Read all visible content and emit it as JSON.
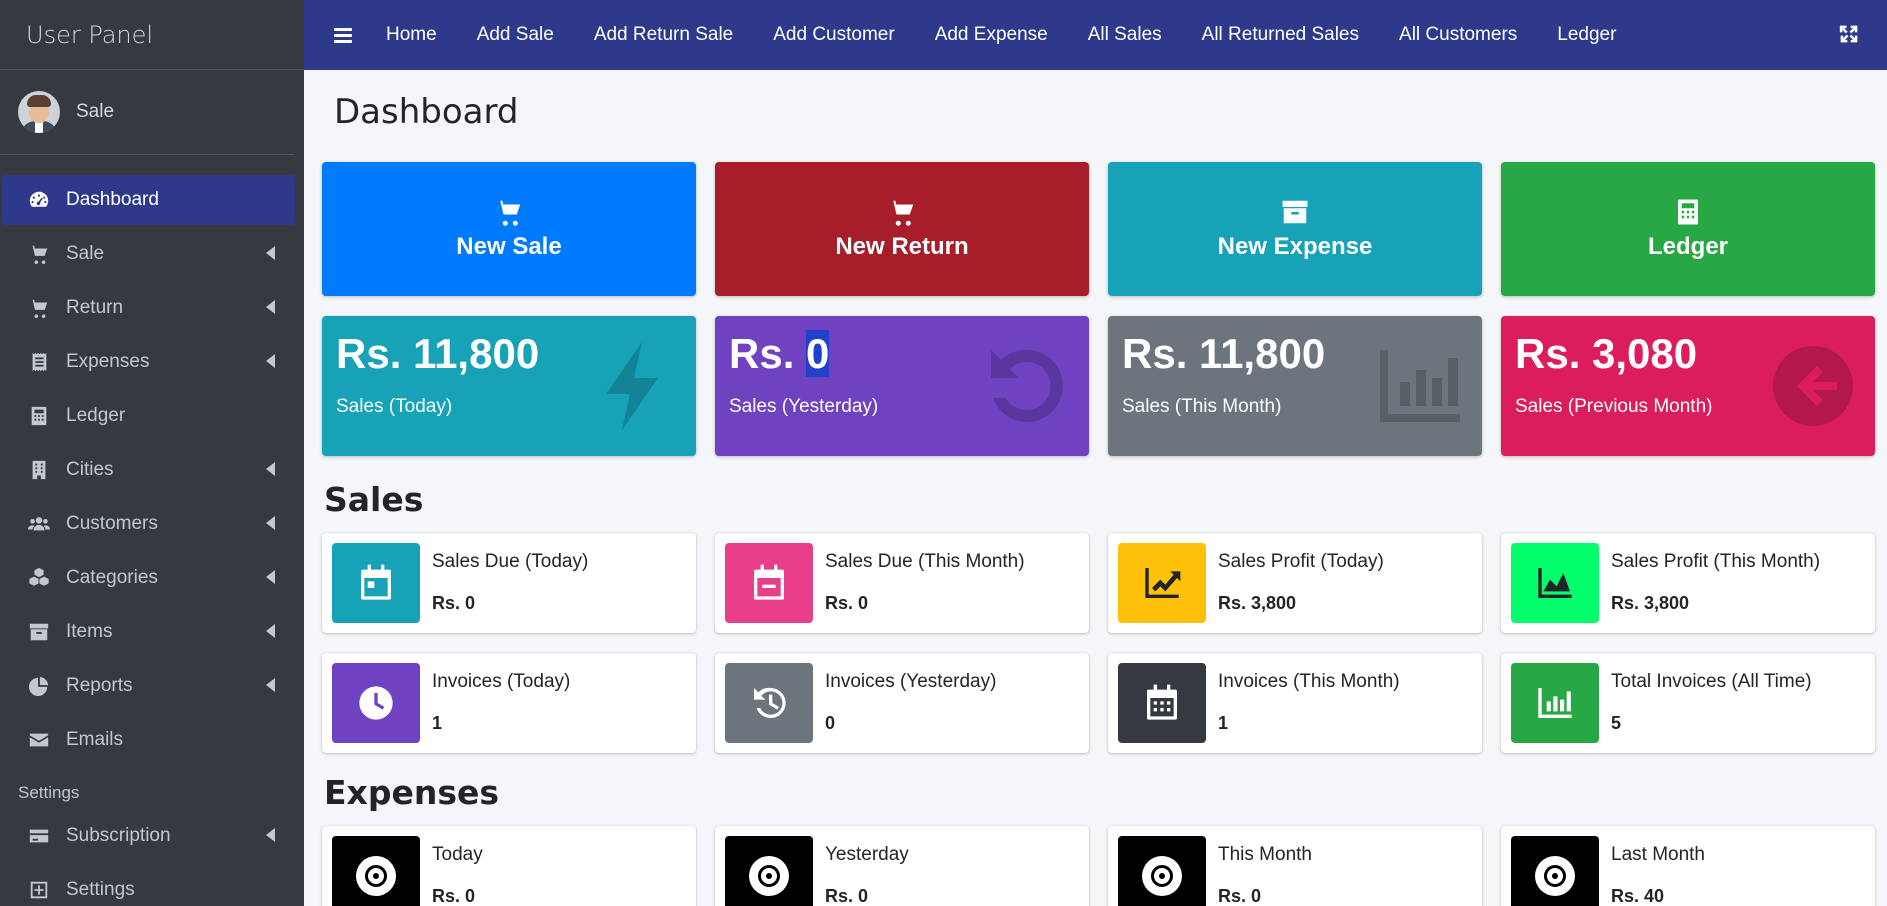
{
  "sidebar": {
    "brand": "User Panel",
    "user_name": "Sale",
    "items": [
      {
        "label": "Dashboard",
        "icon": "dashboard-gauge-icon"
      },
      {
        "label": "Sale",
        "icon": "cart-plus-icon"
      },
      {
        "label": "Return",
        "icon": "cart-return-icon"
      },
      {
        "label": "Expenses",
        "icon": "receipt-icon"
      },
      {
        "label": "Ledger",
        "icon": "calculator-icon"
      },
      {
        "label": "Cities",
        "icon": "building-icon"
      },
      {
        "label": "Customers",
        "icon": "users-icon"
      },
      {
        "label": "Categories",
        "icon": "cubes-icon"
      },
      {
        "label": "Items",
        "icon": "archive-icon"
      },
      {
        "label": "Reports",
        "icon": "pie-chart-icon"
      },
      {
        "label": "Emails",
        "icon": "envelope-icon"
      }
    ],
    "settings_header": "Settings",
    "settings_items": [
      {
        "label": "Subscription",
        "icon": "credit-card-icon"
      },
      {
        "label": "Settings",
        "icon": "plus-square-icon"
      }
    ]
  },
  "topbar": {
    "links": [
      "Home",
      "Add Sale",
      "Add Return Sale",
      "Add Customer",
      "Add Expense",
      "All Sales",
      "All Returned Sales",
      "All Customers",
      "Ledger"
    ]
  },
  "main": {
    "title": "Dashboard",
    "actions": [
      {
        "label": "New Sale",
        "color": "#007bff",
        "icon": "cart-plus-icon"
      },
      {
        "label": "New Return",
        "color": "#a71d2a",
        "icon": "cart-return-icon"
      },
      {
        "label": "New Expense",
        "color": "#17a2b8",
        "icon": "archive-icon"
      },
      {
        "label": "Ledger",
        "color": "#28a745",
        "icon": "calculator-icon"
      }
    ],
    "stats": [
      {
        "prefix": "Rs. ",
        "value": "11,800",
        "caption": "Sales (Today)",
        "color": "#17a2b8",
        "icon": "bolt-icon"
      },
      {
        "prefix": "Rs. ",
        "value": "0",
        "caption": "Sales (Yesterday)",
        "color": "#6f42c1",
        "icon": "undo-icon"
      },
      {
        "prefix": "Rs. ",
        "value": "11,800",
        "caption": "Sales (This Month)",
        "color": "#6c757d",
        "icon": "bar-chart-icon"
      },
      {
        "prefix": "Rs. ",
        "value": "3,080",
        "caption": "Sales (Previous Month)",
        "color": "#dc1d5c",
        "icon": "arrow-circle-left-icon"
      }
    ],
    "sales_title": "Sales",
    "sales_row1": [
      {
        "label": "Sales Due (Today)",
        "value": "Rs. 0",
        "color": "#17a2b8",
        "icon": "calendar-icon"
      },
      {
        "label": "Sales Due (This Month)",
        "value": "Rs. 0",
        "color": "#e83e8c",
        "icon": "calendar-minus-icon"
      },
      {
        "label": "Sales Profit (Today)",
        "value": "Rs. 3,800",
        "color": "#ffc107",
        "icon": "line-chart-icon"
      },
      {
        "label": "Sales Profit (This Month)",
        "value": "Rs. 3,800",
        "color": "#00ff6a",
        "icon": "area-chart-icon"
      }
    ],
    "sales_row2": [
      {
        "label": "Invoices (Today)",
        "value": "1",
        "color": "#6f42c1",
        "icon": "clock-icon"
      },
      {
        "label": "Invoices (Yesterday)",
        "value": "0",
        "color": "#6c757d",
        "icon": "history-icon"
      },
      {
        "label": "Invoices (This Month)",
        "value": "1",
        "color": "#343a40",
        "icon": "calendar-grid-icon"
      },
      {
        "label": "Total Invoices (All Time)",
        "value": "5",
        "color": "#28a745",
        "icon": "bar-chart-icon"
      }
    ],
    "expenses_title": "Expenses",
    "expenses_row": [
      {
        "label": "Today",
        "value": "Rs. 0",
        "color": "#000000",
        "icon": "dot-circle-icon"
      },
      {
        "label": "Yesterday",
        "value": "Rs. 0",
        "color": "#000000",
        "icon": "dot-circle-icon"
      },
      {
        "label": "This Month",
        "value": "Rs. 0",
        "color": "#000000",
        "icon": "dot-circle-icon"
      },
      {
        "label": "Last Month",
        "value": "Rs. 40",
        "color": "#000000",
        "icon": "dot-circle-icon"
      }
    ]
  }
}
